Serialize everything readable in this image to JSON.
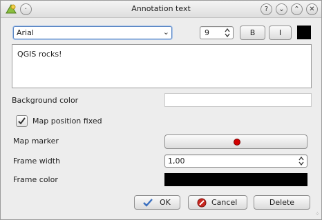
{
  "window": {
    "title": "Annotation text",
    "controls": {
      "help": "?",
      "minimize": "⌄",
      "maximize": "⌃",
      "close": "✕"
    }
  },
  "toolbar": {
    "font_family": "Arial",
    "font_size": "9",
    "bold_label": "B",
    "italic_label": "I",
    "text_color": "#000000"
  },
  "editor": {
    "text": "QGIS rocks!"
  },
  "form": {
    "background_color_label": "Background color",
    "background_color_value": "#ffffff",
    "map_position_fixed_label": "Map position fixed",
    "map_position_fixed_checked": true,
    "map_marker_label": "Map marker",
    "map_marker_color": "#d20000",
    "frame_width_label": "Frame width",
    "frame_width_value": "1,00",
    "frame_color_label": "Frame color",
    "frame_color_value": "#000000"
  },
  "footer": {
    "ok_label": "OK",
    "cancel_label": "Cancel",
    "delete_label": "Delete"
  }
}
